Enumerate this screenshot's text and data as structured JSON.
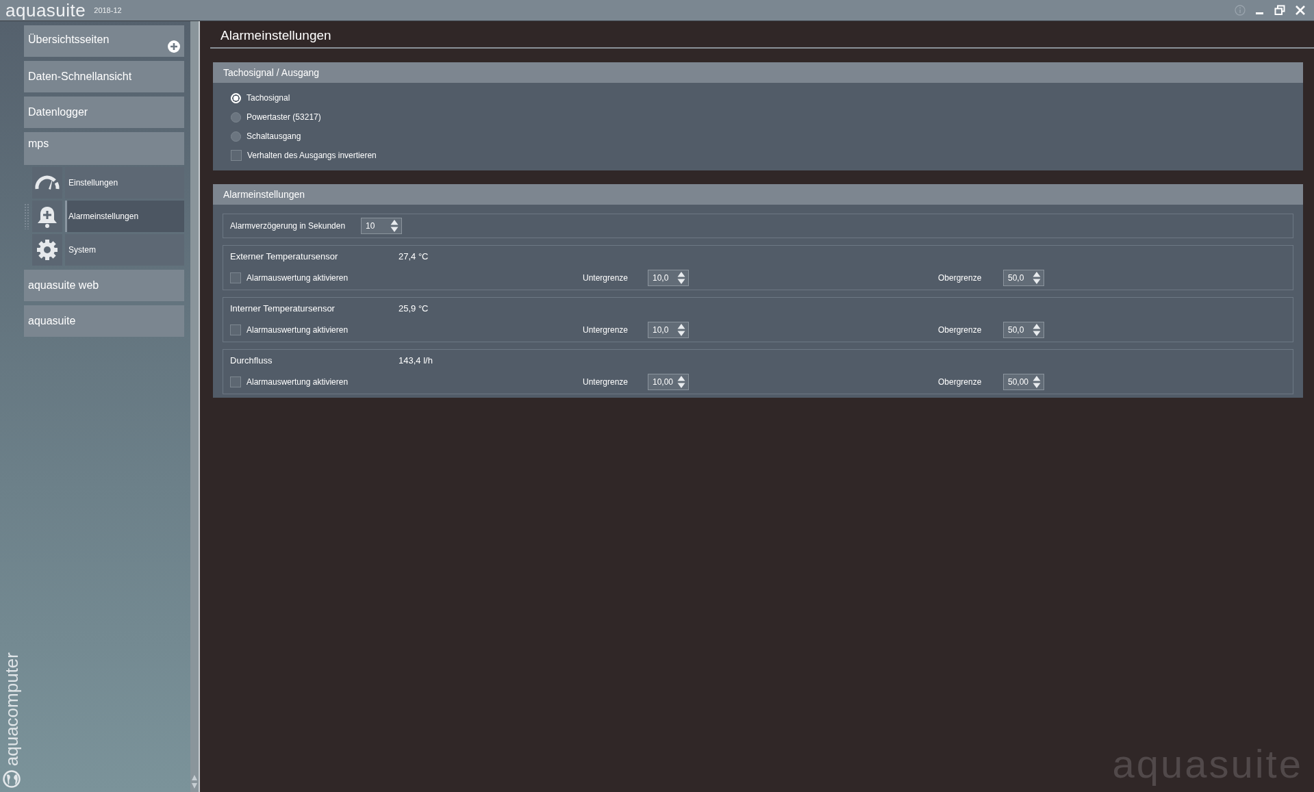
{
  "app": {
    "name": "aquasuite",
    "version": "2018-12"
  },
  "sidebar": {
    "items": [
      {
        "label": "Übersichtsseiten",
        "kind": "add"
      },
      {
        "label": "Daten-Schnellansicht",
        "kind": "plain"
      },
      {
        "label": "Datenlogger",
        "kind": "plain"
      },
      {
        "label": "mps",
        "kind": "group",
        "children": [
          {
            "label": "Einstellungen",
            "selected": false
          },
          {
            "label": "Alarmeinstellungen",
            "selected": true
          },
          {
            "label": "System",
            "selected": false
          }
        ]
      },
      {
        "label": "aquasuite web",
        "kind": "plain"
      },
      {
        "label": "aquasuite",
        "kind": "plain"
      }
    ],
    "brand": "aquacomputer"
  },
  "page_title": "Alarmeinstellungen",
  "output_panel": {
    "title": "Tachosignal / Ausgang",
    "options": [
      {
        "kind": "radio",
        "label": "Tachosignal",
        "selected": true
      },
      {
        "kind": "radio",
        "label": "Powertaster (53217)",
        "selected": false
      },
      {
        "kind": "radio",
        "label": "Schaltausgang",
        "selected": false
      },
      {
        "kind": "checkbox",
        "label": "Verhalten des Ausgangs invertieren",
        "checked": false
      }
    ]
  },
  "alarm_panel": {
    "title": "Alarmeinstellungen",
    "delay": {
      "label": "Alarmverzögerung in Sekunden",
      "value": "10"
    },
    "sensors": [
      {
        "name": "Externer Temperatursensor",
        "reading": "27,4 °C",
        "enable_label": "Alarmauswertung aktivieren",
        "checked": false,
        "lower_label": "Untergrenze",
        "lower": "10,0",
        "upper_label": "Obergrenze",
        "upper": "50,0"
      },
      {
        "name": "Interner Temperatursensor",
        "reading": "25,9 °C",
        "enable_label": "Alarmauswertung aktivieren",
        "checked": false,
        "lower_label": "Untergrenze",
        "lower": "10,0",
        "upper_label": "Obergrenze",
        "upper": "50,0"
      },
      {
        "name": "Durchfluss",
        "reading": "143,4 l/h",
        "enable_label": "Alarmauswertung aktivieren",
        "checked": false,
        "lower_label": "Untergrenze",
        "lower": "10,00",
        "upper_label": "Obergrenze",
        "upper": "50,00"
      }
    ]
  },
  "watermark": "aquasuite"
}
